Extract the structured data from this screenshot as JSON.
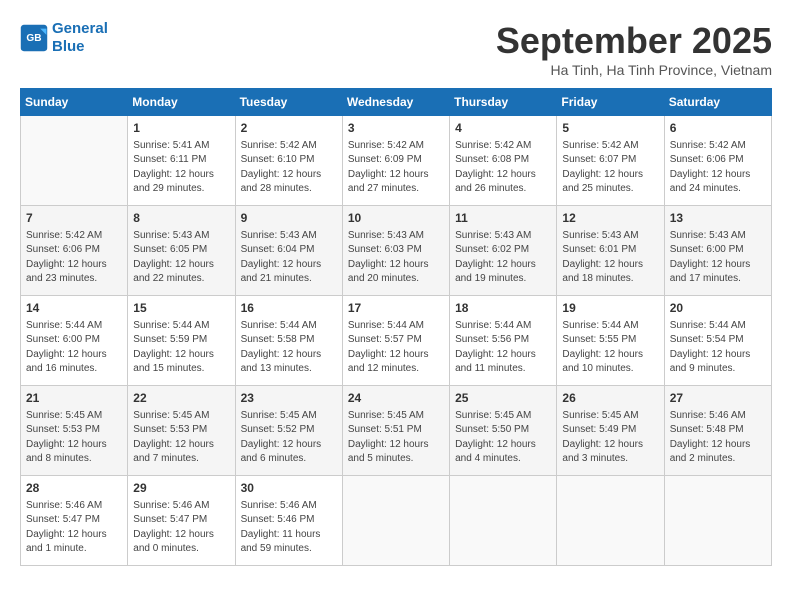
{
  "logo": {
    "line1": "General",
    "line2": "Blue"
  },
  "title": "September 2025",
  "subtitle": "Ha Tinh, Ha Tinh Province, Vietnam",
  "days_of_week": [
    "Sunday",
    "Monday",
    "Tuesday",
    "Wednesday",
    "Thursday",
    "Friday",
    "Saturday"
  ],
  "weeks": [
    [
      {
        "day": "",
        "info": ""
      },
      {
        "day": "1",
        "info": "Sunrise: 5:41 AM\nSunset: 6:11 PM\nDaylight: 12 hours\nand 29 minutes."
      },
      {
        "day": "2",
        "info": "Sunrise: 5:42 AM\nSunset: 6:10 PM\nDaylight: 12 hours\nand 28 minutes."
      },
      {
        "day": "3",
        "info": "Sunrise: 5:42 AM\nSunset: 6:09 PM\nDaylight: 12 hours\nand 27 minutes."
      },
      {
        "day": "4",
        "info": "Sunrise: 5:42 AM\nSunset: 6:08 PM\nDaylight: 12 hours\nand 26 minutes."
      },
      {
        "day": "5",
        "info": "Sunrise: 5:42 AM\nSunset: 6:07 PM\nDaylight: 12 hours\nand 25 minutes."
      },
      {
        "day": "6",
        "info": "Sunrise: 5:42 AM\nSunset: 6:06 PM\nDaylight: 12 hours\nand 24 minutes."
      }
    ],
    [
      {
        "day": "7",
        "info": "Sunrise: 5:42 AM\nSunset: 6:06 PM\nDaylight: 12 hours\nand 23 minutes."
      },
      {
        "day": "8",
        "info": "Sunrise: 5:43 AM\nSunset: 6:05 PM\nDaylight: 12 hours\nand 22 minutes."
      },
      {
        "day": "9",
        "info": "Sunrise: 5:43 AM\nSunset: 6:04 PM\nDaylight: 12 hours\nand 21 minutes."
      },
      {
        "day": "10",
        "info": "Sunrise: 5:43 AM\nSunset: 6:03 PM\nDaylight: 12 hours\nand 20 minutes."
      },
      {
        "day": "11",
        "info": "Sunrise: 5:43 AM\nSunset: 6:02 PM\nDaylight: 12 hours\nand 19 minutes."
      },
      {
        "day": "12",
        "info": "Sunrise: 5:43 AM\nSunset: 6:01 PM\nDaylight: 12 hours\nand 18 minutes."
      },
      {
        "day": "13",
        "info": "Sunrise: 5:43 AM\nSunset: 6:00 PM\nDaylight: 12 hours\nand 17 minutes."
      }
    ],
    [
      {
        "day": "14",
        "info": "Sunrise: 5:44 AM\nSunset: 6:00 PM\nDaylight: 12 hours\nand 16 minutes."
      },
      {
        "day": "15",
        "info": "Sunrise: 5:44 AM\nSunset: 5:59 PM\nDaylight: 12 hours\nand 15 minutes."
      },
      {
        "day": "16",
        "info": "Sunrise: 5:44 AM\nSunset: 5:58 PM\nDaylight: 12 hours\nand 13 minutes."
      },
      {
        "day": "17",
        "info": "Sunrise: 5:44 AM\nSunset: 5:57 PM\nDaylight: 12 hours\nand 12 minutes."
      },
      {
        "day": "18",
        "info": "Sunrise: 5:44 AM\nSunset: 5:56 PM\nDaylight: 12 hours\nand 11 minutes."
      },
      {
        "day": "19",
        "info": "Sunrise: 5:44 AM\nSunset: 5:55 PM\nDaylight: 12 hours\nand 10 minutes."
      },
      {
        "day": "20",
        "info": "Sunrise: 5:44 AM\nSunset: 5:54 PM\nDaylight: 12 hours\nand 9 minutes."
      }
    ],
    [
      {
        "day": "21",
        "info": "Sunrise: 5:45 AM\nSunset: 5:53 PM\nDaylight: 12 hours\nand 8 minutes."
      },
      {
        "day": "22",
        "info": "Sunrise: 5:45 AM\nSunset: 5:53 PM\nDaylight: 12 hours\nand 7 minutes."
      },
      {
        "day": "23",
        "info": "Sunrise: 5:45 AM\nSunset: 5:52 PM\nDaylight: 12 hours\nand 6 minutes."
      },
      {
        "day": "24",
        "info": "Sunrise: 5:45 AM\nSunset: 5:51 PM\nDaylight: 12 hours\nand 5 minutes."
      },
      {
        "day": "25",
        "info": "Sunrise: 5:45 AM\nSunset: 5:50 PM\nDaylight: 12 hours\nand 4 minutes."
      },
      {
        "day": "26",
        "info": "Sunrise: 5:45 AM\nSunset: 5:49 PM\nDaylight: 12 hours\nand 3 minutes."
      },
      {
        "day": "27",
        "info": "Sunrise: 5:46 AM\nSunset: 5:48 PM\nDaylight: 12 hours\nand 2 minutes."
      }
    ],
    [
      {
        "day": "28",
        "info": "Sunrise: 5:46 AM\nSunset: 5:47 PM\nDaylight: 12 hours\nand 1 minute."
      },
      {
        "day": "29",
        "info": "Sunrise: 5:46 AM\nSunset: 5:47 PM\nDaylight: 12 hours\nand 0 minutes."
      },
      {
        "day": "30",
        "info": "Sunrise: 5:46 AM\nSunset: 5:46 PM\nDaylight: 11 hours\nand 59 minutes."
      },
      {
        "day": "",
        "info": ""
      },
      {
        "day": "",
        "info": ""
      },
      {
        "day": "",
        "info": ""
      },
      {
        "day": "",
        "info": ""
      }
    ]
  ]
}
